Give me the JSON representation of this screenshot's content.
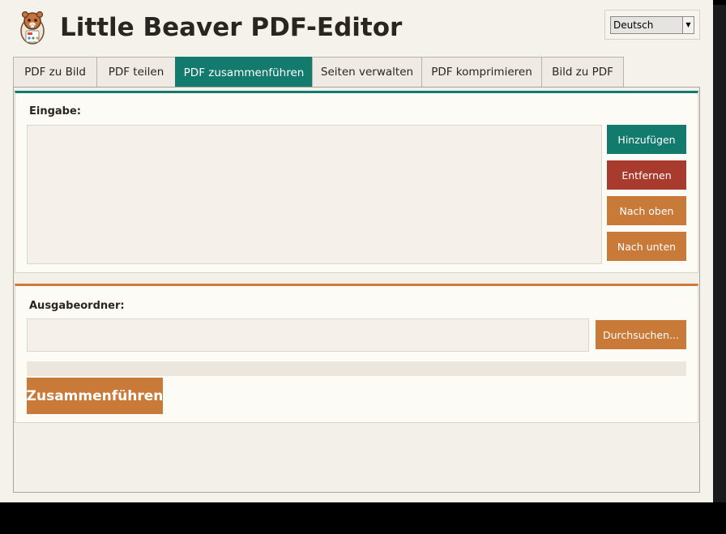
{
  "app": {
    "title": "Little Beaver PDF-Editor"
  },
  "language": {
    "selected": "Deutsch"
  },
  "tabs": [
    {
      "label": "PDF zu Bild",
      "active": false
    },
    {
      "label": "PDF teilen",
      "active": false
    },
    {
      "label": "PDF zusammenführen",
      "active": true
    },
    {
      "label": "Seiten verwalten",
      "active": false
    },
    {
      "label": "PDF komprimieren",
      "active": false
    },
    {
      "label": "Bild zu PDF",
      "active": false
    }
  ],
  "input_section": {
    "label": "Eingabe:",
    "buttons": {
      "add": "Hinzufügen",
      "remove": "Entfernen",
      "up": "Nach oben",
      "down": "Nach unten"
    }
  },
  "output_section": {
    "label": "Ausgabeordner:",
    "folder_value": "",
    "browse": "Durchsuchen...",
    "progress": 0,
    "merge": "Zusammenführen"
  },
  "colors": {
    "accent": "#137a6e",
    "danger": "#a83a2e",
    "warm": "#c97a38"
  }
}
